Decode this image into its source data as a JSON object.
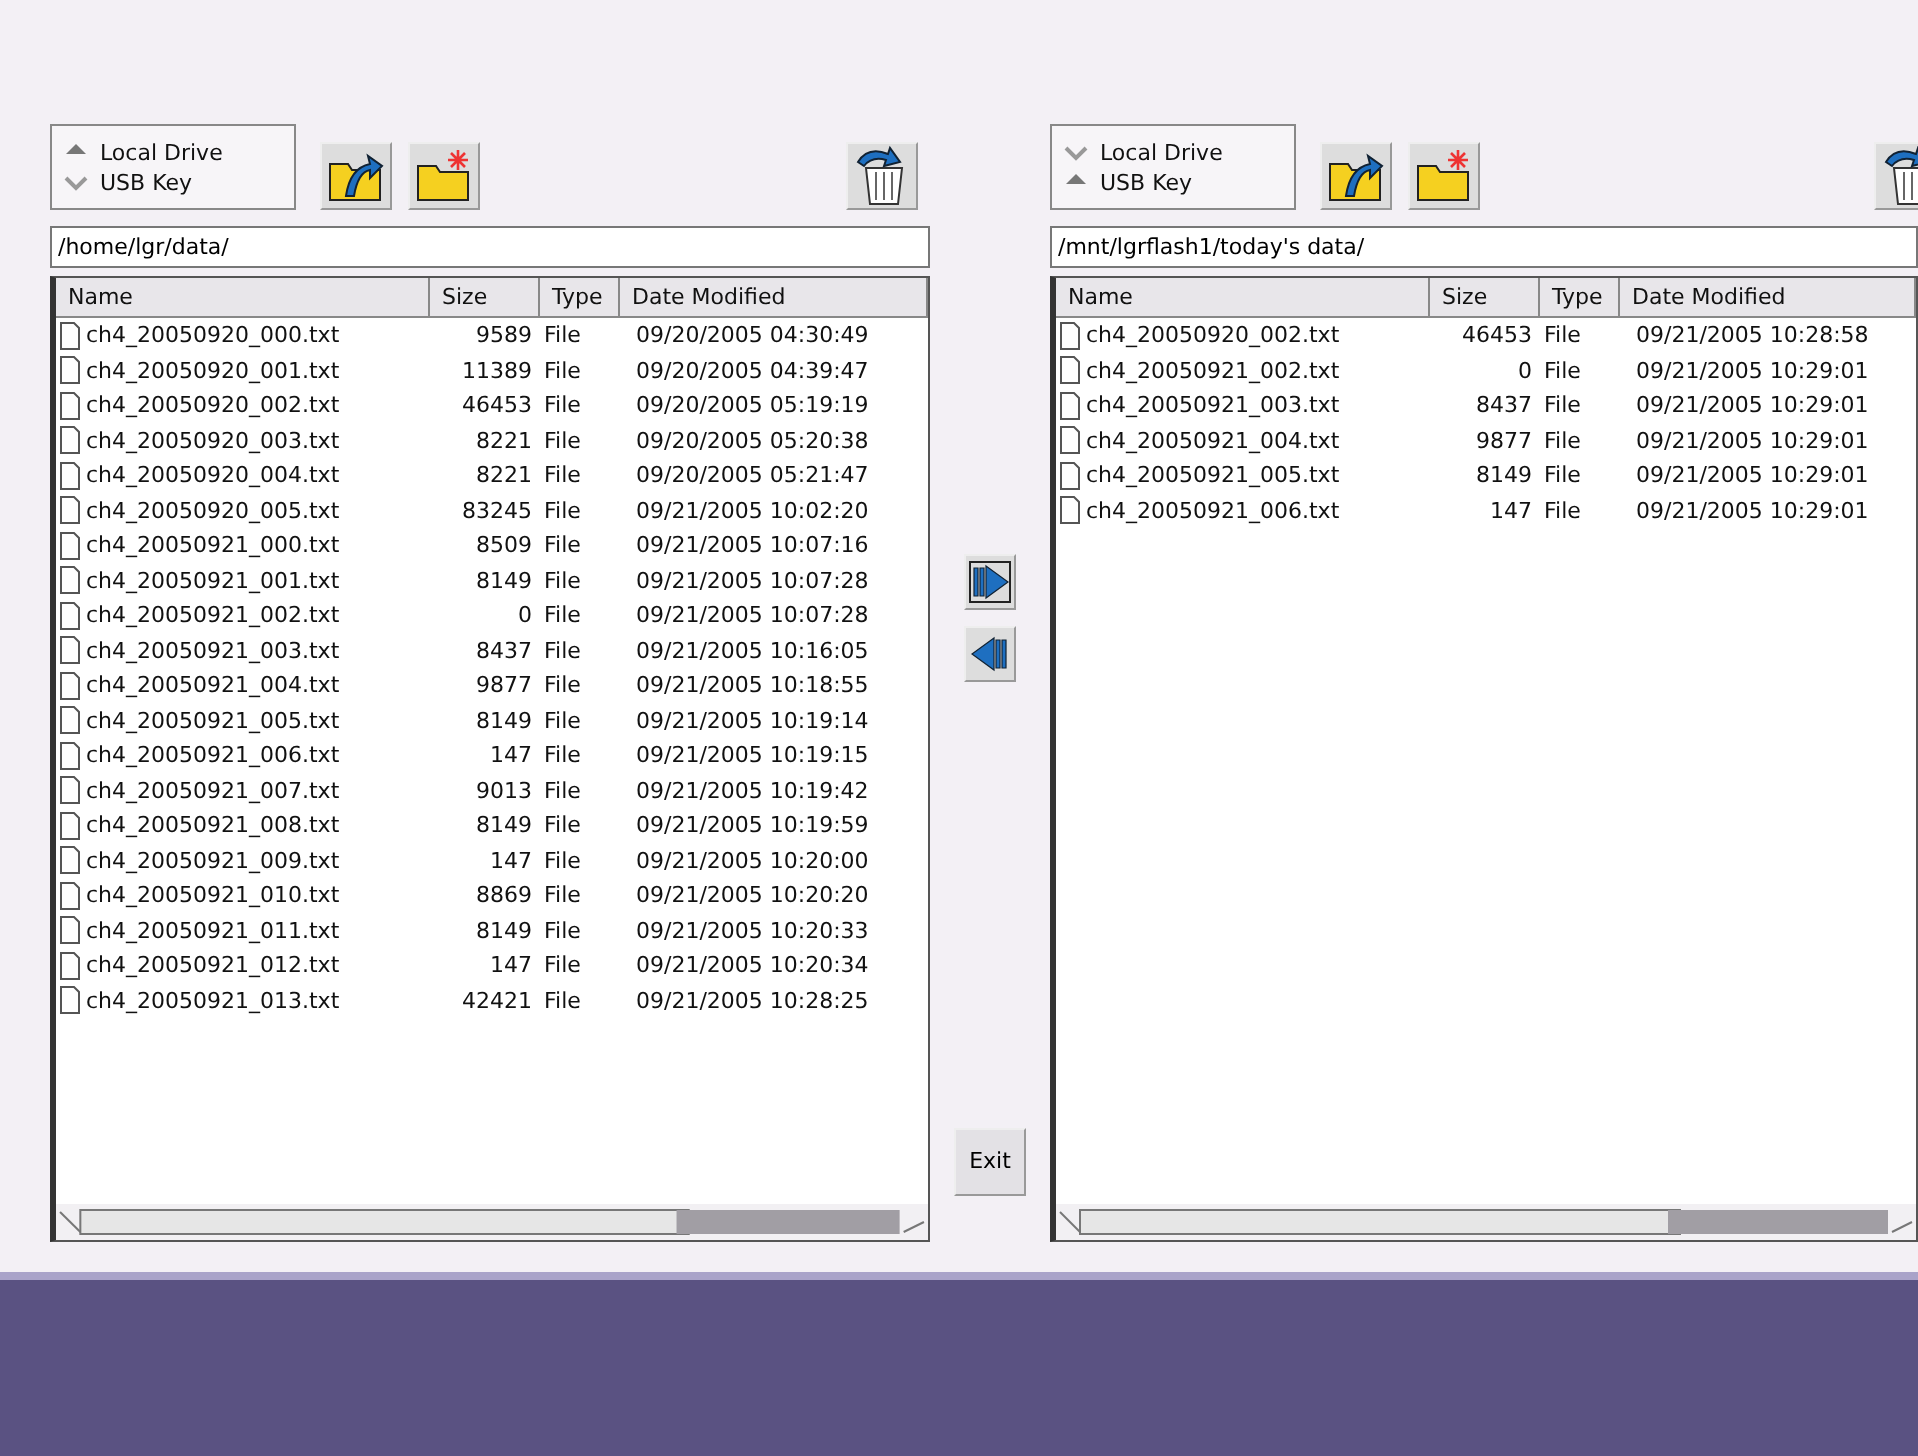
{
  "panes": [
    {
      "drives": [
        {
          "label": "Local Drive",
          "selected": true
        },
        {
          "label": "USB Key",
          "selected": false
        }
      ],
      "path": "/home/lgr/data/",
      "columns": [
        "Name",
        "Size",
        "Type",
        "Date Modified"
      ],
      "rows": [
        [
          "ch4_20050920_000.txt",
          "9589",
          "File",
          "09/20/2005 04:30:49"
        ],
        [
          "ch4_20050920_001.txt",
          "11389",
          "File",
          "09/20/2005 04:39:47"
        ],
        [
          "ch4_20050920_002.txt",
          "46453",
          "File",
          "09/20/2005 05:19:19"
        ],
        [
          "ch4_20050920_003.txt",
          "8221",
          "File",
          "09/20/2005 05:20:38"
        ],
        [
          "ch4_20050920_004.txt",
          "8221",
          "File",
          "09/20/2005 05:21:47"
        ],
        [
          "ch4_20050920_005.txt",
          "83245",
          "File",
          "09/21/2005 10:02:20"
        ],
        [
          "ch4_20050921_000.txt",
          "8509",
          "File",
          "09/21/2005 10:07:16"
        ],
        [
          "ch4_20050921_001.txt",
          "8149",
          "File",
          "09/21/2005 10:07:28"
        ],
        [
          "ch4_20050921_002.txt",
          "0",
          "File",
          "09/21/2005 10:07:28"
        ],
        [
          "ch4_20050921_003.txt",
          "8437",
          "File",
          "09/21/2005 10:16:05"
        ],
        [
          "ch4_20050921_004.txt",
          "9877",
          "File",
          "09/21/2005 10:18:55"
        ],
        [
          "ch4_20050921_005.txt",
          "8149",
          "File",
          "09/21/2005 10:19:14"
        ],
        [
          "ch4_20050921_006.txt",
          "147",
          "File",
          "09/21/2005 10:19:15"
        ],
        [
          "ch4_20050921_007.txt",
          "9013",
          "File",
          "09/21/2005 10:19:42"
        ],
        [
          "ch4_20050921_008.txt",
          "8149",
          "File",
          "09/21/2005 10:19:59"
        ],
        [
          "ch4_20050921_009.txt",
          "147",
          "File",
          "09/21/2005 10:20:00"
        ],
        [
          "ch4_20050921_010.txt",
          "8869",
          "File",
          "09/21/2005 10:20:20"
        ],
        [
          "ch4_20050921_011.txt",
          "8149",
          "File",
          "09/21/2005 10:20:33"
        ],
        [
          "ch4_20050921_012.txt",
          "147",
          "File",
          "09/21/2005 10:20:34"
        ],
        [
          "ch4_20050921_013.txt",
          "42421",
          "File",
          "09/21/2005 10:28:25"
        ]
      ]
    },
    {
      "drives": [
        {
          "label": "Local Drive",
          "selected": false
        },
        {
          "label": "USB Key",
          "selected": true
        }
      ],
      "path": "/mnt/lgrflash1/today's data/",
      "columns": [
        "Name",
        "Size",
        "Type",
        "Date Modified"
      ],
      "rows": [
        [
          "ch4_20050920_002.txt",
          "46453",
          "File",
          "09/21/2005 10:28:58"
        ],
        [
          "ch4_20050921_002.txt",
          "0",
          "File",
          "09/21/2005 10:29:01"
        ],
        [
          "ch4_20050921_003.txt",
          "8437",
          "File",
          "09/21/2005 10:29:01"
        ],
        [
          "ch4_20050921_004.txt",
          "9877",
          "File",
          "09/21/2005 10:29:01"
        ],
        [
          "ch4_20050921_005.txt",
          "8149",
          "File",
          "09/21/2005 10:29:01"
        ],
        [
          "ch4_20050921_006.txt",
          "147",
          "File",
          "09/21/2005 10:29:01"
        ]
      ]
    }
  ],
  "exit_button": "Exit"
}
